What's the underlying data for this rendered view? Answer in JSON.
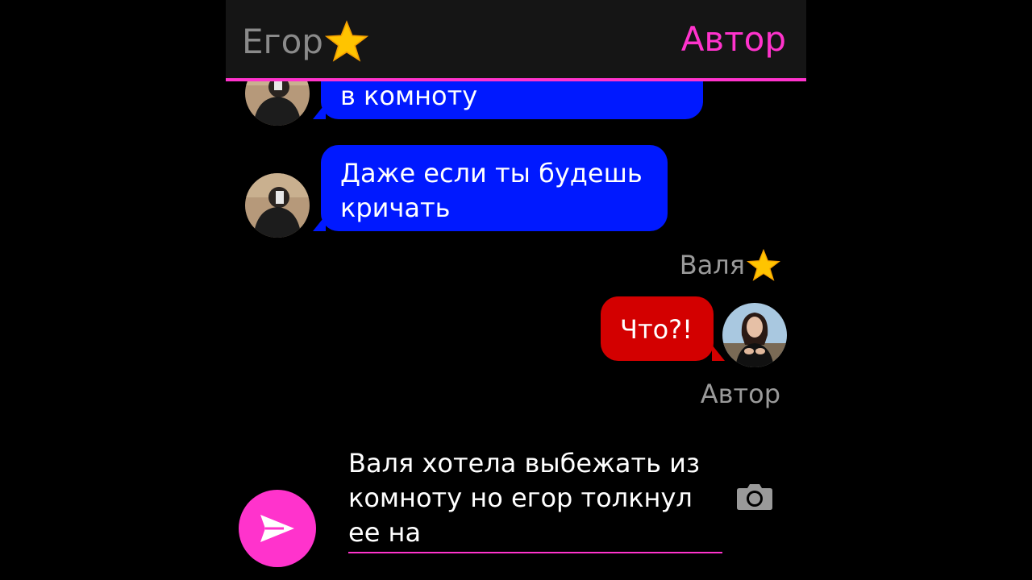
{
  "header": {
    "left_name": "Егор",
    "right_name": "Автор",
    "left_icon": "star-icon"
  },
  "messages": [
    {
      "sender": "Егор",
      "side": "left",
      "text_lines": [
        "в комноту"
      ],
      "color": "#0019ff"
    },
    {
      "sender": "Егор",
      "side": "left",
      "text_lines": [
        "Даже если ты будешь",
        "кричать"
      ],
      "color": "#0019ff"
    },
    {
      "sender": "Валя",
      "side": "right",
      "text_lines": [
        "Что?!"
      ],
      "color": "#d30000"
    }
  ],
  "labels": {
    "valya": "Валя",
    "avtor": "Автор"
  },
  "composer": {
    "text_lines": [
      "Валя хотела выбежать из",
      "комноту но егор толкнул",
      "ее на"
    ],
    "send_icon": "send-icon",
    "camera_icon": "camera-icon"
  },
  "colors": {
    "accent": "#ff33cc",
    "blue_bubble": "#0019ff",
    "red_bubble": "#d30000",
    "header_bg": "#151515"
  }
}
